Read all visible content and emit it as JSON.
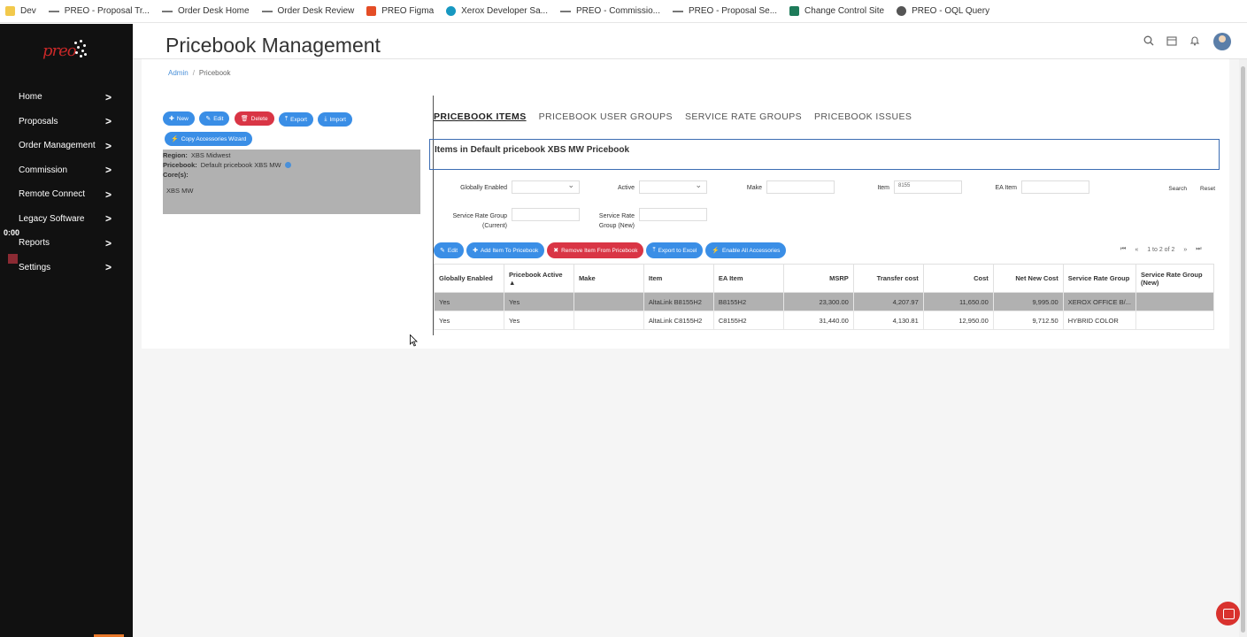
{
  "bookmarks": [
    {
      "label": "Dev",
      "icon": "folder-icon"
    },
    {
      "label": "PREO - Proposal Tr...",
      "icon": "arrow-icon"
    },
    {
      "label": "Order Desk Home",
      "icon": "arrow-icon"
    },
    {
      "label": "Order Desk Review",
      "icon": "arrow-icon"
    },
    {
      "label": "PREO Figma",
      "icon": "figma-icon"
    },
    {
      "label": "Xerox Developer Sa...",
      "icon": "cloud-icon"
    },
    {
      "label": "PREO - Commissio...",
      "icon": "arrow-icon"
    },
    {
      "label": "PREO - Proposal Se...",
      "icon": "arrow-icon"
    },
    {
      "label": "Change Control Site",
      "icon": "sharepoint-icon"
    },
    {
      "label": "PREO - OQL Query",
      "icon": "globe-icon"
    }
  ],
  "sidebar": {
    "logo": "preo",
    "items": [
      {
        "label": "Home"
      },
      {
        "label": "Proposals"
      },
      {
        "label": "Order Management"
      },
      {
        "label": "Commission"
      },
      {
        "label": "Remote Connect"
      },
      {
        "label": "Legacy Software"
      },
      {
        "label": "Reports"
      },
      {
        "label": "Settings"
      }
    ],
    "chevron": ">",
    "timer": "0:00"
  },
  "header": {
    "title": "Pricebook Management"
  },
  "breadcrumb": {
    "admin": "Admin",
    "separator": "/",
    "current": "Pricebook"
  },
  "left_panel": {
    "buttons": {
      "new": "New",
      "edit": "Edit",
      "delete": "Delete",
      "export": "Export",
      "import": "Import",
      "wizard": "Copy Accessories Wizard"
    },
    "region_label": "Region:",
    "region_value": "XBS Midwest",
    "pricebook_label": "Pricebook:",
    "pricebook_value": "Default pricebook XBS MW",
    "cores_label": "Core(s):",
    "cores_value": "XBS MW"
  },
  "tabs": [
    {
      "label": "PRICEBOOK ITEMS",
      "active": true
    },
    {
      "label": "PRICEBOOK USER GROUPS",
      "active": false
    },
    {
      "label": "SERVICE RATE GROUPS",
      "active": false
    },
    {
      "label": "PRICEBOOK ISSUES",
      "active": false
    }
  ],
  "items_title": "Items in Default pricebook XBS MW Pricebook",
  "filters": {
    "globally_enabled_label": "Globally Enabled",
    "active_label": "Active",
    "make_label": "Make",
    "item_label": "Item",
    "item_value": "8155",
    "ea_item_label": "EA Item",
    "srg_current_label": "Service Rate Group (Current)",
    "srg_new_label": "Service Rate Group (New)",
    "search": "Search",
    "reset": "Reset"
  },
  "table_buttons": {
    "edit": "Edit",
    "add": "Add Item To Pricebook",
    "remove": "Remove Item From Pricebook",
    "export": "Export to Excel",
    "enable": "Enable All Accessories"
  },
  "pager": {
    "text": "1 to 2 of 2"
  },
  "table": {
    "columns": [
      "Globally Enabled",
      "Pricebook Active ▲",
      "Make",
      "Item",
      "EA Item",
      "MSRP",
      "Transfer cost",
      "Cost",
      "Net New Cost",
      "Service Rate Group",
      "Service Rate Group (New)"
    ],
    "rows": [
      [
        "Yes",
        "Yes",
        "",
        "AltaLink B8155H2",
        "B8155H2",
        "23,300.00",
        "4,207.97",
        "11,650.00",
        "9,995.00",
        "XEROX OFFICE B/...",
        ""
      ],
      [
        "Yes",
        "Yes",
        "",
        "AltaLink C8155H2",
        "C8155H2",
        "31,440.00",
        "4,130.81",
        "12,950.00",
        "9,712.50",
        "HYBRID COLOR",
        ""
      ]
    ],
    "selected_row": 0
  }
}
